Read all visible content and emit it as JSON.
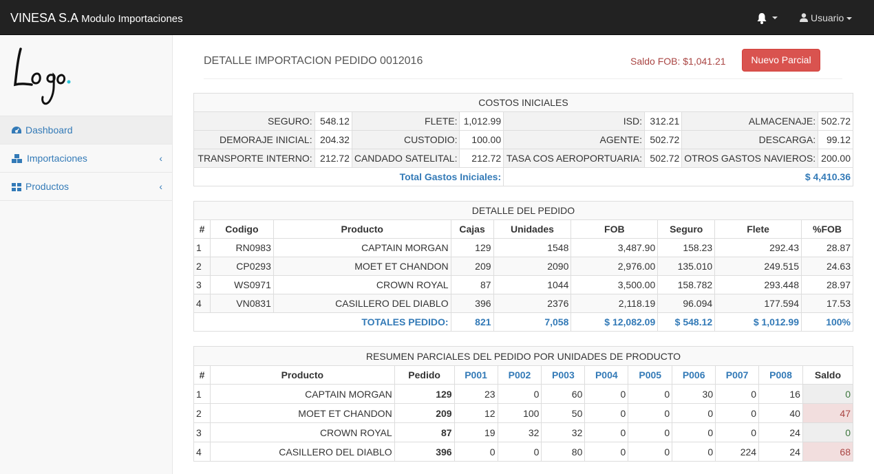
{
  "navbar": {
    "brand": "VINESA S.A",
    "brand_sub": "Modulo Importaciones",
    "user_label": "Usuario"
  },
  "sidebar": {
    "logo_text": "Logo",
    "items": [
      {
        "label": "Dashboard",
        "icon": "dashboard-icon"
      },
      {
        "label": "Importaciones",
        "icon": "cubes-icon"
      },
      {
        "label": "Productos",
        "icon": "grid-icon"
      }
    ]
  },
  "header": {
    "title": "DETALLE IMPORTACION PEDIDO 0012016",
    "saldo": "Saldo FOB: $1,041.21",
    "button": "Nuevo Parcial"
  },
  "costos": {
    "caption": "COSTOS INICIALES",
    "rows": [
      [
        [
          "SEGURO:",
          "548.12"
        ],
        [
          "FLETE:",
          "1,012.99"
        ],
        [
          "ISD:",
          "312.21"
        ],
        [
          "ALMACENAJE:",
          "502.72"
        ]
      ],
      [
        [
          "DEMORAJE INICIAL:",
          "204.32"
        ],
        [
          "CUSTODIO:",
          "100.00"
        ],
        [
          "AGENTE:",
          "502.72"
        ],
        [
          "DESCARGA:",
          "99.12"
        ]
      ],
      [
        [
          "TRANSPORTE INTERNO:",
          "212.72"
        ],
        [
          "CANDADO SATELITAL:",
          "212.72"
        ],
        [
          "TASA COS AEROPORTUARIA:",
          "502.72"
        ],
        [
          "OTROS GASTOS NAVIEROS:",
          "200.00"
        ]
      ]
    ],
    "total_label": "Total Gastos Iniciales:",
    "total_value": "$ 4,410.36"
  },
  "detalle": {
    "caption": "DETALLE DEL PEDIDO",
    "headers": [
      "#",
      "Codigo",
      "Producto",
      "Cajas",
      "Unidades",
      "FOB",
      "Seguro",
      "Flete",
      "%FOB"
    ],
    "rows": [
      [
        "1",
        "RN0983",
        "CAPTAIN MORGAN",
        "129",
        "1548",
        "3,487.90",
        "158.23",
        "292.43",
        "28.87"
      ],
      [
        "2",
        "CP0293",
        "MOET ET CHANDON",
        "209",
        "2090",
        "2,976.00",
        "135.010",
        "249.515",
        "24.63"
      ],
      [
        "3",
        "WS0971",
        "CROWN ROYAL",
        "87",
        "1044",
        "3,500.00",
        "158.782",
        "293.448",
        "28.97"
      ],
      [
        "4",
        "VN0831",
        "CASILLERO DEL DIABLO",
        "396",
        "2376",
        "2,118.19",
        "96.094",
        "177.594",
        "17.53"
      ]
    ],
    "totals": {
      "label": "TOTALES PEDIDO:",
      "cajas": "821",
      "unidades": "7,058",
      "fob": "$ 12,082.09",
      "seguro": "$ 548.12",
      "flete": "$ 1,012.99",
      "pct": "100%"
    }
  },
  "resumen": {
    "caption": "RESUMEN PARCIALES DEL PEDIDO POR UNIDADES DE PRODUCTO",
    "headers": [
      "#",
      "Producto",
      "Pedido",
      "P001",
      "P002",
      "P003",
      "P004",
      "P005",
      "P006",
      "P007",
      "P008",
      "Saldo"
    ],
    "rows": [
      [
        "1",
        "CAPTAIN MORGAN",
        "129",
        "23",
        "0",
        "60",
        "0",
        "0",
        "30",
        "0",
        "16",
        "0"
      ],
      [
        "2",
        "MOET ET CHANDON",
        "209",
        "12",
        "100",
        "50",
        "0",
        "0",
        "0",
        "0",
        "40",
        "47"
      ],
      [
        "3",
        "CROWN ROYAL",
        "87",
        "19",
        "32",
        "32",
        "0",
        "0",
        "0",
        "0",
        "24",
        "0"
      ],
      [
        "4",
        "CASILLERO DEL DIABLO",
        "396",
        "0",
        "0",
        "80",
        "0",
        "0",
        "0",
        "224",
        "24",
        "68"
      ]
    ]
  },
  "colors": {
    "navbar": "#222222",
    "link": "#337ab7",
    "danger": "#d9534f",
    "saldo_text": "#a94442",
    "ok_text": "#3c763d"
  }
}
